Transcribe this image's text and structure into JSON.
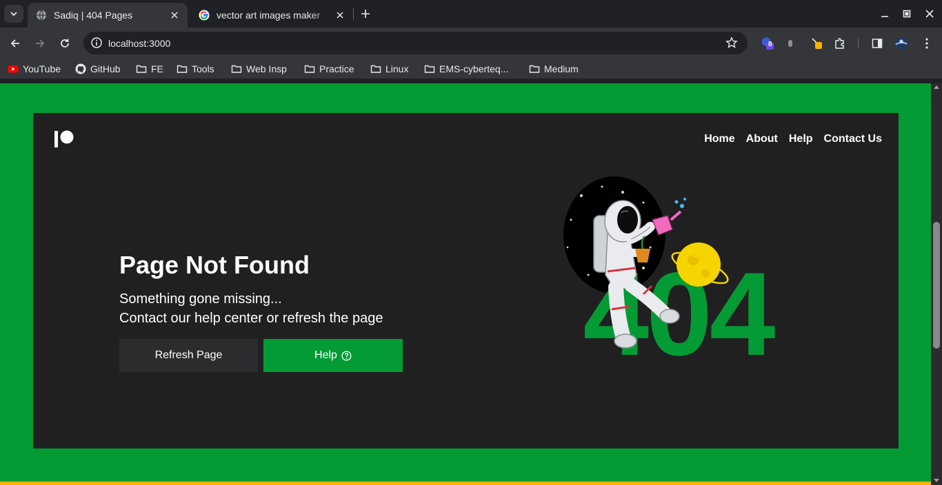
{
  "browser": {
    "tabs": [
      {
        "title": "Sadiq | 404 Pages",
        "active": true
      },
      {
        "title": "vector art images maker",
        "active": false
      }
    ],
    "url": "localhost:3000",
    "extension_badge": "8",
    "bookmarks": [
      {
        "label": "YouTube",
        "icon": "youtube-icon"
      },
      {
        "label": "GitHub",
        "icon": "github-icon"
      },
      {
        "label": "FE",
        "icon": "folder-icon"
      },
      {
        "label": "Tools",
        "icon": "folder-icon"
      },
      {
        "label": "Web Insp",
        "icon": "folder-icon"
      },
      {
        "label": "Practice",
        "icon": "folder-icon"
      },
      {
        "label": "Linux",
        "icon": "folder-icon"
      },
      {
        "label": "EMS-cyberteq...",
        "icon": "folder-icon"
      },
      {
        "label": "Medium",
        "icon": "folder-icon"
      }
    ]
  },
  "page": {
    "nav": [
      "Home",
      "About",
      "Help",
      "Contact Us"
    ],
    "title": "Page Not Found",
    "message_line1": "Something gone missing...",
    "message_line2": "Contact our help center or refresh the page",
    "refresh_label": "Refresh Page",
    "help_label": "Help",
    "error_code": "404"
  },
  "colors": {
    "background_green": "#049b35",
    "card_dark": "#202021",
    "accent_yellow": "#f5b400"
  }
}
